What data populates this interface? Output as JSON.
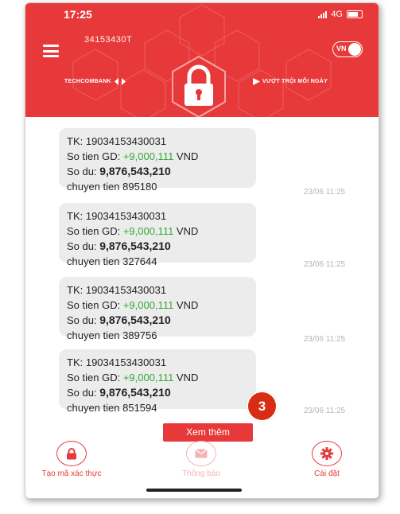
{
  "status_bar": {
    "time": "17:25",
    "network": "4G"
  },
  "header": {
    "account_number": "34153430T",
    "language_toggle": "VN",
    "bank_name": "TECHCOMBANK",
    "slogan": "VƯỢT TRỘI MỖI NGÀY"
  },
  "messages": [
    {
      "account": "TK: 19034153430031",
      "amount_label": "So tien GD: ",
      "amount": "+9,000,111",
      "currency": " VND",
      "balance_label": "So du: ",
      "balance": "9,876,543,210",
      "description": "chuyen tien 895180",
      "time": "23/06 11:25"
    },
    {
      "account": "TK: 19034153430031",
      "amount_label": "So tien GD: ",
      "amount": "+9,000,111",
      "currency": " VND",
      "balance_label": "So du: ",
      "balance": "9,876,543,210",
      "description": "chuyen tien 327644",
      "time": "23/06 11:25"
    },
    {
      "account": "TK: 19034153430031",
      "amount_label": "So tien GD: ",
      "amount": "+9,000,111",
      "currency": " VND",
      "balance_label": "So du: ",
      "balance": "9,876,543,210",
      "description": "chuyen tien 389756",
      "time": "23/06 11:25"
    },
    {
      "account": "TK: 19034153430031",
      "amount_label": "So tien GD: ",
      "amount": "+9,000,111",
      "currency": " VND",
      "balance_label": "So du: ",
      "balance": "9,876,543,210",
      "description": "chuyen tien 851594",
      "time": "23/06 11:25"
    }
  ],
  "annotation_badge": "3",
  "more_button": "Xem thêm",
  "bottom_nav": {
    "create_code": "Tạo mã xác thực",
    "notifications": "Thông báo",
    "settings": "Cài đặt"
  },
  "icons": [
    "menu-icon",
    "lock-icon",
    "signal-icon",
    "battery-icon",
    "envelope-icon",
    "gear-icon"
  ],
  "colors": {
    "brand_red": "#e8393a",
    "amount_green": "#35a83a",
    "badge_red": "#d92c14"
  }
}
